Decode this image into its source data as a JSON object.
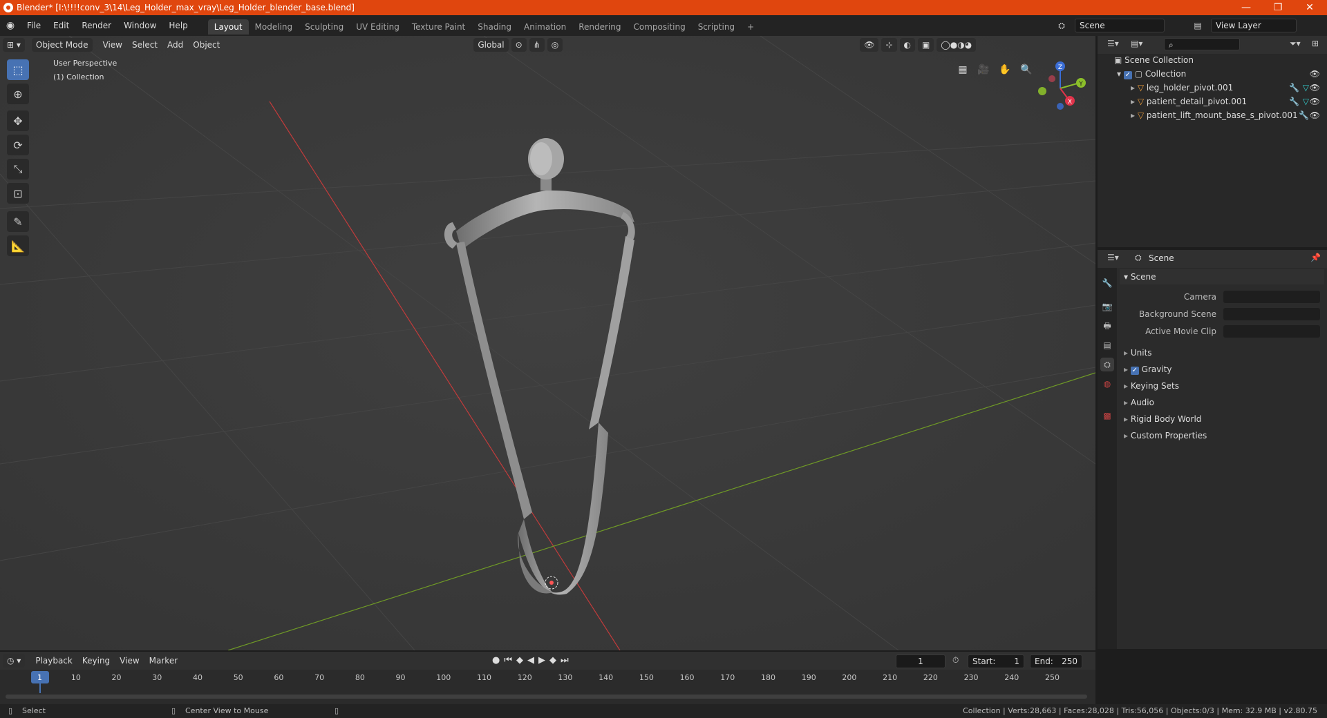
{
  "window": {
    "title": "Blender* [I:\\!!!!conv_3\\14\\Leg_Holder_max_vray\\Leg_Holder_blender_base.blend]",
    "minimize": "—",
    "maximize": "❐",
    "close": "✕"
  },
  "menu": {
    "items": [
      "File",
      "Edit",
      "Render",
      "Window",
      "Help"
    ],
    "workspaces": [
      "Layout",
      "Modeling",
      "Sculpting",
      "UV Editing",
      "Texture Paint",
      "Shading",
      "Animation",
      "Rendering",
      "Compositing",
      "Scripting"
    ],
    "active_workspace": "Layout",
    "add_tab": "+",
    "scene": "Scene",
    "view_layer": "View Layer"
  },
  "viewport": {
    "mode": "Object Mode",
    "menus": [
      "View",
      "Select",
      "Add",
      "Object"
    ],
    "orientation": "Global",
    "overlay_title": "User Perspective",
    "overlay_collection": "(1) Collection",
    "gizmo": {
      "z": "Z",
      "y": "Y",
      "x": "X"
    }
  },
  "outliner": {
    "root": "Scene Collection",
    "collection": "Collection",
    "objects": [
      "leg_holder_pivot.001",
      "patient_detail_pivot.001",
      "patient_lift_mount_base_s_pivot.001"
    ]
  },
  "properties": {
    "header": "Scene",
    "section": "Scene",
    "fields": [
      {
        "label": "Camera"
      },
      {
        "label": "Background Scene"
      },
      {
        "label": "Active Movie Clip"
      }
    ],
    "panels": [
      "Units",
      "Gravity",
      "Keying Sets",
      "Audio",
      "Rigid Body World",
      "Custom Properties"
    ],
    "gravity_checked": true
  },
  "timeline": {
    "menus": [
      "Playback",
      "Keying",
      "View",
      "Marker"
    ],
    "current_frame": "1",
    "start_label": "Start:",
    "start": "1",
    "end_label": "End:",
    "end": "250",
    "ticks": [
      "1",
      "10",
      "20",
      "30",
      "40",
      "50",
      "60",
      "70",
      "80",
      "90",
      "100",
      "110",
      "120",
      "130",
      "140",
      "150",
      "160",
      "170",
      "180",
      "190",
      "200",
      "210",
      "220",
      "230",
      "240",
      "250"
    ]
  },
  "status": {
    "left": "Select",
    "middle": "Center View to Mouse",
    "right": "Collection | Verts:28,663 | Faces:28,028 | Tris:56,056 | Objects:0/3 | Mem: 32.9 MB | v2.80.75"
  },
  "colors": {
    "titlebar": "#e0460e",
    "accent": "#4772b3",
    "x_axis": "#c23b3b",
    "y_axis": "#6f9a26"
  }
}
